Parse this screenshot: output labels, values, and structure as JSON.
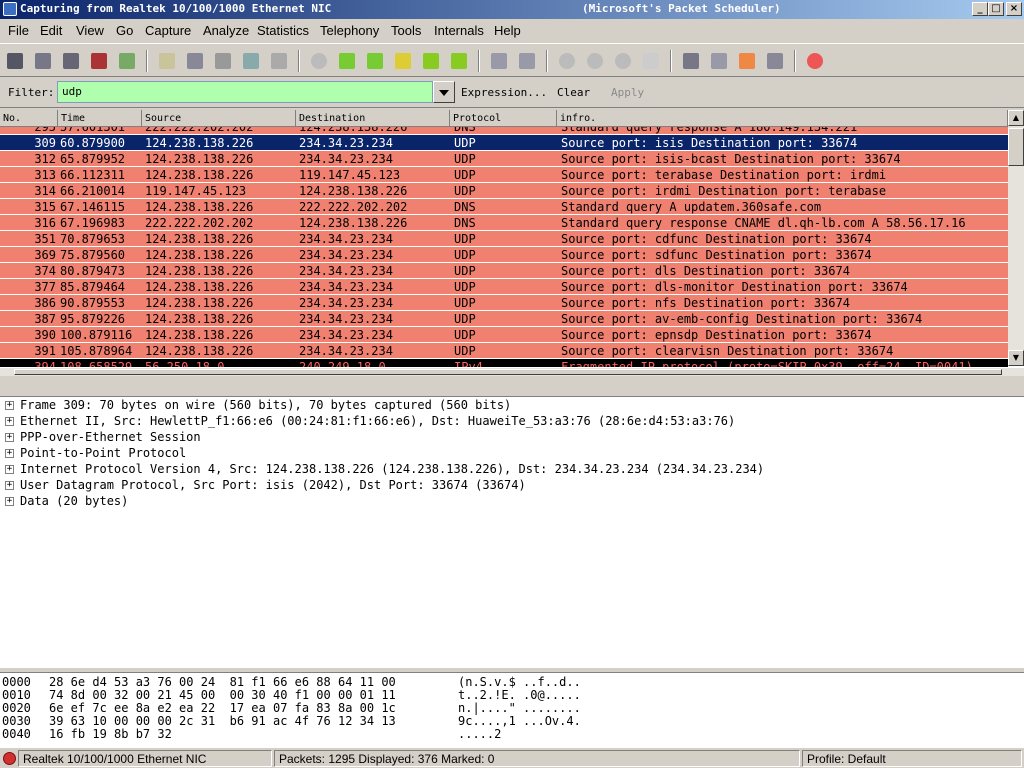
{
  "window": {
    "title": "Capturing from Realtek 10/100/1000 Ethernet NIC",
    "title_extra": "(Microsoft's Packet Scheduler)"
  },
  "menu": [
    "File",
    "Edit",
    "View",
    "Go",
    "Capture",
    "Analyze",
    "Statistics",
    "Telephony",
    "Tools",
    "Internals",
    "Help"
  ],
  "filter": {
    "label": "Filter:",
    "value": "udp",
    "expression_label": "Expression...",
    "clear_label": "Clear",
    "apply_label": "Apply",
    "bg_color": "#afffaf"
  },
  "packet_list": {
    "columns": [
      "No.",
      "Time",
      "Source",
      "Destination",
      "Protocol",
      "infro."
    ],
    "partial_top": {
      "no": "295",
      "time": "57.601301",
      "src": "222.222.202.202",
      "dst": "124.238.138.226",
      "proto": "DNS",
      "info": "Standard query response A 180.149.134.221"
    },
    "rows": [
      {
        "no": "309",
        "time": "60.879900",
        "src": "124.238.138.226",
        "dst": "234.34.23.234",
        "proto": "UDP",
        "info": "Source port: isis  Destination port: 33674",
        "selected": true
      },
      {
        "no": "312",
        "time": "65.879952",
        "src": "124.238.138.226",
        "dst": "234.34.23.234",
        "proto": "UDP",
        "info": "Source port: isis-bcast  Destination port: 33674"
      },
      {
        "no": "313",
        "time": "66.112311",
        "src": "124.238.138.226",
        "dst": "119.147.45.123",
        "proto": "UDP",
        "info": "Source port: terabase  Destination port: irdmi"
      },
      {
        "no": "314",
        "time": "66.210014",
        "src": "119.147.45.123",
        "dst": "124.238.138.226",
        "proto": "UDP",
        "info": "Source port: irdmi  Destination port: terabase"
      },
      {
        "no": "315",
        "time": "67.146115",
        "src": "124.238.138.226",
        "dst": "222.222.202.202",
        "proto": "DNS",
        "info": "Standard query A updatem.360safe.com"
      },
      {
        "no": "316",
        "time": "67.196983",
        "src": "222.222.202.202",
        "dst": "124.238.138.226",
        "proto": "DNS",
        "info": "Standard query response CNAME dl.qh-lb.com A 58.56.17.16"
      },
      {
        "no": "351",
        "time": "70.879653",
        "src": "124.238.138.226",
        "dst": "234.34.23.234",
        "proto": "UDP",
        "info": "Source port: cdfunc  Destination port: 33674"
      },
      {
        "no": "369",
        "time": "75.879560",
        "src": "124.238.138.226",
        "dst": "234.34.23.234",
        "proto": "UDP",
        "info": "Source port: sdfunc  Destination port: 33674"
      },
      {
        "no": "374",
        "time": "80.879473",
        "src": "124.238.138.226",
        "dst": "234.34.23.234",
        "proto": "UDP",
        "info": "Source port: dls  Destination port: 33674"
      },
      {
        "no": "377",
        "time": "85.879464",
        "src": "124.238.138.226",
        "dst": "234.34.23.234",
        "proto": "UDP",
        "info": "Source port: dls-monitor  Destination port: 33674"
      },
      {
        "no": "386",
        "time": "90.879553",
        "src": "124.238.138.226",
        "dst": "234.34.23.234",
        "proto": "UDP",
        "info": "Source port: nfs  Destination port: 33674"
      },
      {
        "no": "387",
        "time": "95.879226",
        "src": "124.238.138.226",
        "dst": "234.34.23.234",
        "proto": "UDP",
        "info": "Source port: av-emb-config  Destination port: 33674"
      },
      {
        "no": "390",
        "time": "100.879116",
        "src": "124.238.138.226",
        "dst": "234.34.23.234",
        "proto": "UDP",
        "info": "Source port: epnsdp  Destination port: 33674"
      },
      {
        "no": "391",
        "time": "105.878964",
        "src": "124.238.138.226",
        "dst": "234.34.23.234",
        "proto": "UDP",
        "info": "Source port: clearvisn  Destination port: 33674"
      }
    ],
    "partial_bottom": {
      "no": "394",
      "time": "108.658529",
      "src": "56.250.18.0",
      "dst": "240.249.18.0",
      "proto": "IPv4",
      "info": "Fragmented IP protocol (proto=SKIP 0x39, off=24, ID=0041)"
    },
    "colors": {
      "row_bg": "#f08070",
      "selected_bg": "#0a246a",
      "selected_fg": "#ffffff",
      "bad_bg": "#000000",
      "bad_fg": "#ff6060"
    }
  },
  "details": [
    "Frame 309: 70 bytes on wire (560 bits), 70 bytes captured (560 bits)",
    "Ethernet II, Src: HewlettP_f1:66:e6 (00:24:81:f1:66:e6), Dst: HuaweiTe_53:a3:76 (28:6e:d4:53:a3:76)",
    "PPP-over-Ethernet Session",
    "Point-to-Point Protocol",
    "Internet Protocol Version 4, Src: 124.238.138.226 (124.238.138.226), Dst: 234.34.23.234 (234.34.23.234)",
    "User Datagram Protocol, Src Port: isis (2042), Dst Port: 33674 (33674)",
    "Data (20 bytes)"
  ],
  "bytes": [
    {
      "offset": "0000",
      "hex": "28 6e d4 53 a3 76 00 24  81 f1 66 e6 88 64 11 00",
      "ascii": "(n.S.v.$ ..f..d.."
    },
    {
      "offset": "0010",
      "hex": "74 8d 00 32 00 21 45 00  00 30 40 f1 00 00 01 11",
      "ascii": "t..2.!E. .0@....."
    },
    {
      "offset": "0020",
      "hex": "6e ef 7c ee 8a e2 ea 22  17 ea 07 fa 83 8a 00 1c",
      "ascii": "n.|....\" ........"
    },
    {
      "offset": "0030",
      "hex": "39 63 10 00 00 00 2c 31  b6 91 ac 4f 76 12 34 13",
      "ascii": "9c....,1 ...Ov.4."
    },
    {
      "offset": "0040",
      "hex": "16 fb 19 8b b7 32",
      "ascii": ".....2"
    }
  ],
  "status": {
    "interface": "Realtek 10/100/1000 Ethernet NIC",
    "packets": "Packets: 1295 Displayed: 376 Marked: 0",
    "profile": "Profile: Default"
  }
}
